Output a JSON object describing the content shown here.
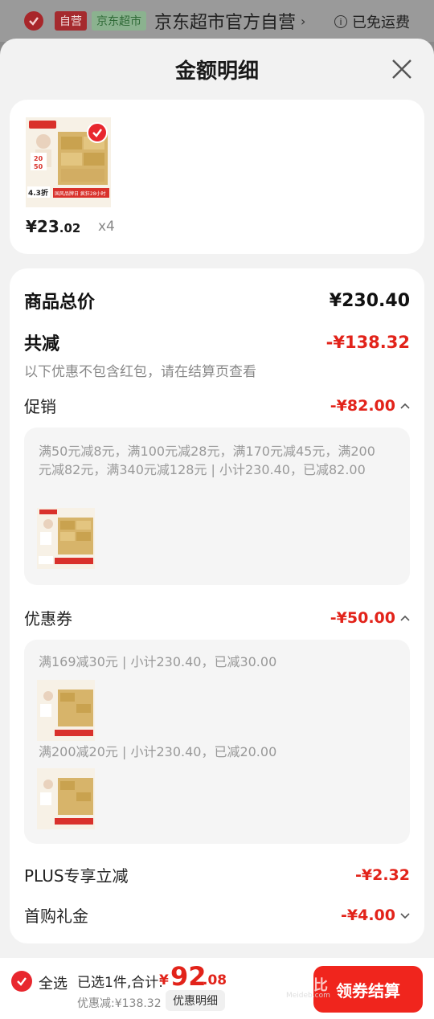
{
  "store": {
    "self_tag": "自营",
    "jd_tag": "京东超市",
    "name": "京东超市官方自营",
    "chevron": "›",
    "shipping": "已免运费"
  },
  "sheet": {
    "title": "金额明细"
  },
  "product": {
    "price_main": "¥23",
    "price_dec": ".02",
    "qty": "x4",
    "thumb_texts": {
      "badge_20": "20",
      "badge_50": "50",
      "discount": "4.3折",
      "banner": "国风品牌日 疯狂28小时"
    }
  },
  "detail": {
    "total_label": "商品总价",
    "total_amount": "¥230.40",
    "reduce_label": "共减",
    "reduce_amount": "-¥138.32",
    "note": "以下优惠不包含红包，请在结算页查看",
    "promo_label": "促销",
    "promo_amount": "-¥82.00",
    "promo_desc": "满50元减8元，满100元减28元，满170元减45元，满200元减82元，满340元减128元 | 小计230.40，已减82.00",
    "coupon_label": "优惠券",
    "coupon_amount": "-¥50.00",
    "coupon1_desc": "满169减30元 | 小计230.40，已减30.00",
    "coupon2_desc": "满200减20元 | 小计230.40，已减20.00",
    "plus_label": "PLUS专享立减",
    "plus_amount": "-¥2.32",
    "first_label": "首购礼金",
    "first_amount": "-¥4.00"
  },
  "bottom": {
    "select_all": "全选",
    "selected": "已选1件,合计:",
    "total_symbol": "¥",
    "total_int": "92",
    "total_dec": ".08",
    "discount": "优惠减:¥138.32",
    "detail_btn": "优惠明细",
    "checkout": "领券结算",
    "watermark": "没得比",
    "watermark_sub": "Meideb.com"
  },
  "colors": {
    "accent_red": "#e2231a",
    "button_red": "#f0251d"
  },
  "icons": {
    "close": "close-icon",
    "check": "check-icon",
    "info": "info-icon",
    "chevron_up": "chevron-up-icon",
    "chevron_down": "chevron-down-icon"
  }
}
